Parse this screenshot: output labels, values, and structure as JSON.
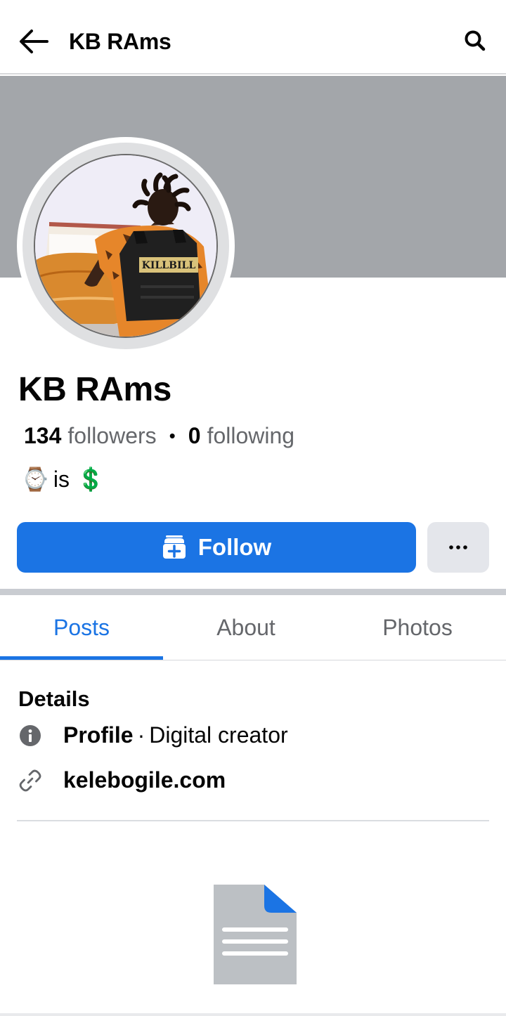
{
  "topbar": {
    "title": "KB RAms"
  },
  "profile": {
    "name": "KB RAms",
    "followers_count": "134",
    "followers_label": "followers",
    "following_count": "0",
    "following_label": "following",
    "stats_separator": "•",
    "bio": {
      "emoji_1": "⌚",
      "text": "is",
      "emoji_2": "💲"
    },
    "avatar_vest_text": "KILLBILL"
  },
  "actions": {
    "follow_label": "Follow",
    "more_label": "···"
  },
  "tabs": [
    {
      "label": "Posts",
      "active": true
    },
    {
      "label": "About",
      "active": false
    },
    {
      "label": "Photos",
      "active": false
    }
  ],
  "details": {
    "heading": "Details",
    "profile_type_label": "Profile",
    "profile_separator": "·",
    "profile_type_value": "Digital creator",
    "website": "kelebogile.com"
  },
  "colors": {
    "accent": "#1b74e4",
    "cover": "#a3a6aa",
    "secondary_text": "#65676b"
  },
  "icons": [
    "back-arrow-icon",
    "search-icon",
    "follow-box-icon",
    "more-dots-icon",
    "info-icon",
    "link-icon",
    "document-icon"
  ]
}
